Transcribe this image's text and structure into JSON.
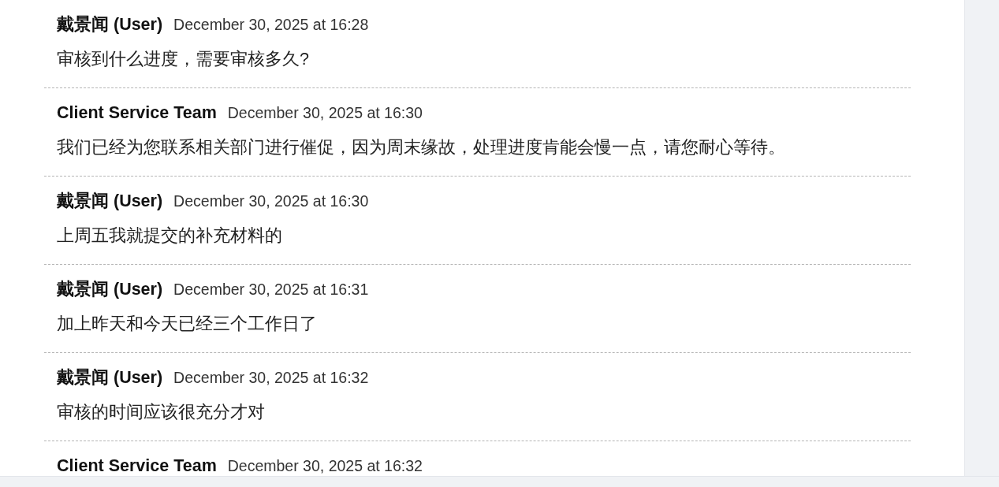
{
  "messages": [
    {
      "author": "戴景闻 (User)",
      "time": "December 30, 2025 at 16:28",
      "body": "审核到什么进度，需要审核多久?"
    },
    {
      "author": "Client Service Team",
      "time": "December 30, 2025 at 16:30",
      "body": "我们已经为您联系相关部门进行催促，因为周末缘故，处理进度肯能会慢一点，请您耐心等待。"
    },
    {
      "author": "戴景闻 (User)",
      "time": "December 30, 2025 at 16:30",
      "body": "上周五我就提交的补充材料的"
    },
    {
      "author": "戴景闻 (User)",
      "time": "December 30, 2025 at 16:31",
      "body": "加上昨天和今天已经三个工作日了"
    },
    {
      "author": "戴景闻 (User)",
      "time": "December 30, 2025 at 16:32",
      "body": "审核的时间应该很充分才对"
    },
    {
      "author": "Client Service Team",
      "time": "December 30, 2025 at 16:32"
    }
  ]
}
